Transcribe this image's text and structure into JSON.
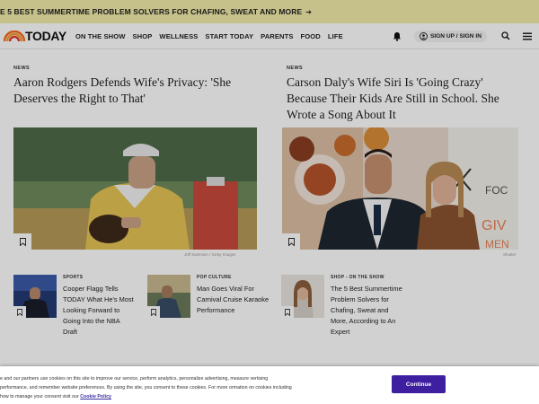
{
  "promo": {
    "text": "E 5 BEST SUMMERTIME PROBLEM SOLVERS FOR CHAFING, SWEAT AND MORE",
    "arrow": "➔"
  },
  "nav": {
    "logo_text": "TODAY",
    "links": [
      "ON THE SHOW",
      "SHOP",
      "WELLNESS",
      "START TODAY",
      "PARENTS",
      "FOOD",
      "LIFE"
    ],
    "signin_label": "SIGN UP / SIGN IN"
  },
  "featured": [
    {
      "label": "NEWS",
      "headline": "Aaron Rodgers Defends Wife's Privacy: 'She Deserves the Right to That'",
      "credit": "Jeff Swensen / Getty Images"
    },
    {
      "label": "NEWS",
      "headline": "Carson Daly's Wife Siri Is 'Going Crazy' Because Their Kids Are Still in School. She Wrote a Song About It",
      "credit": "Shutter",
      "sign_text": "FOC",
      "sign_text2": "GIV",
      "sign_text3": "MEN"
    }
  ],
  "small_cards": [
    {
      "label": "SPORTS",
      "title": "Cooper Flagg Tells TODAY What He's Most Looking Forward to Going Into the NBA Draft"
    },
    {
      "label": "POP CULTURE",
      "title": "Man Goes Viral For Carnival Cruise Karaoke Performance"
    },
    {
      "label": "SHOP - ON THE SHOW",
      "title": "The 5 Best Summertime Problem Solvers for Chafing, Sweat and More, According to An Expert"
    }
  ],
  "consent": {
    "text": "e and our partners use cookies on this site to improve our service, perform analytics, personalize advertising, measure vertising performance, and remember website preferences. By using the site, you consent to these cookies. For more ormation on cookies including how to manage your consent visit our",
    "policy_link": "Cookie Policy",
    "button": "Continue"
  }
}
